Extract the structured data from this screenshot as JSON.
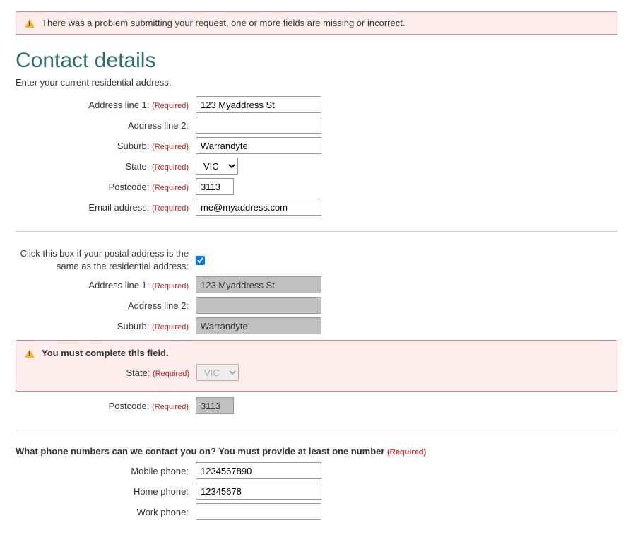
{
  "alert": {
    "message": "There was a problem submitting your request, one or more fields are missing or incorrect."
  },
  "heading": "Contact details",
  "hint": "Enter your current residential address.",
  "required": "(Required)",
  "labels": {
    "addr1": "Address line 1:",
    "addr2": "Address line 2:",
    "suburb": "Suburb:",
    "state": "State:",
    "postcode": "Postcode:",
    "email": "Email address:",
    "same_postal": "Click this box if your postal address is the same as the residential address:",
    "mobile": "Mobile phone:",
    "home": "Home phone:",
    "work": "Work phone:"
  },
  "residential": {
    "addr1": "123 Myaddress St",
    "addr2": "",
    "suburb": "Warrandyte",
    "state": "VIC",
    "postcode": "3113",
    "email": "me@myaddress.com"
  },
  "postal": {
    "same_checked": true,
    "addr1": "123 Myaddress St",
    "addr2": "",
    "suburb": "Warrandyte",
    "state": "VIC",
    "postcode": "3113"
  },
  "error_field": "You must complete this field.",
  "phone_question": "What phone numbers can we contact you on? You must provide at least one number",
  "phone": {
    "mobile": "1234567890",
    "home": "12345678",
    "work": ""
  }
}
